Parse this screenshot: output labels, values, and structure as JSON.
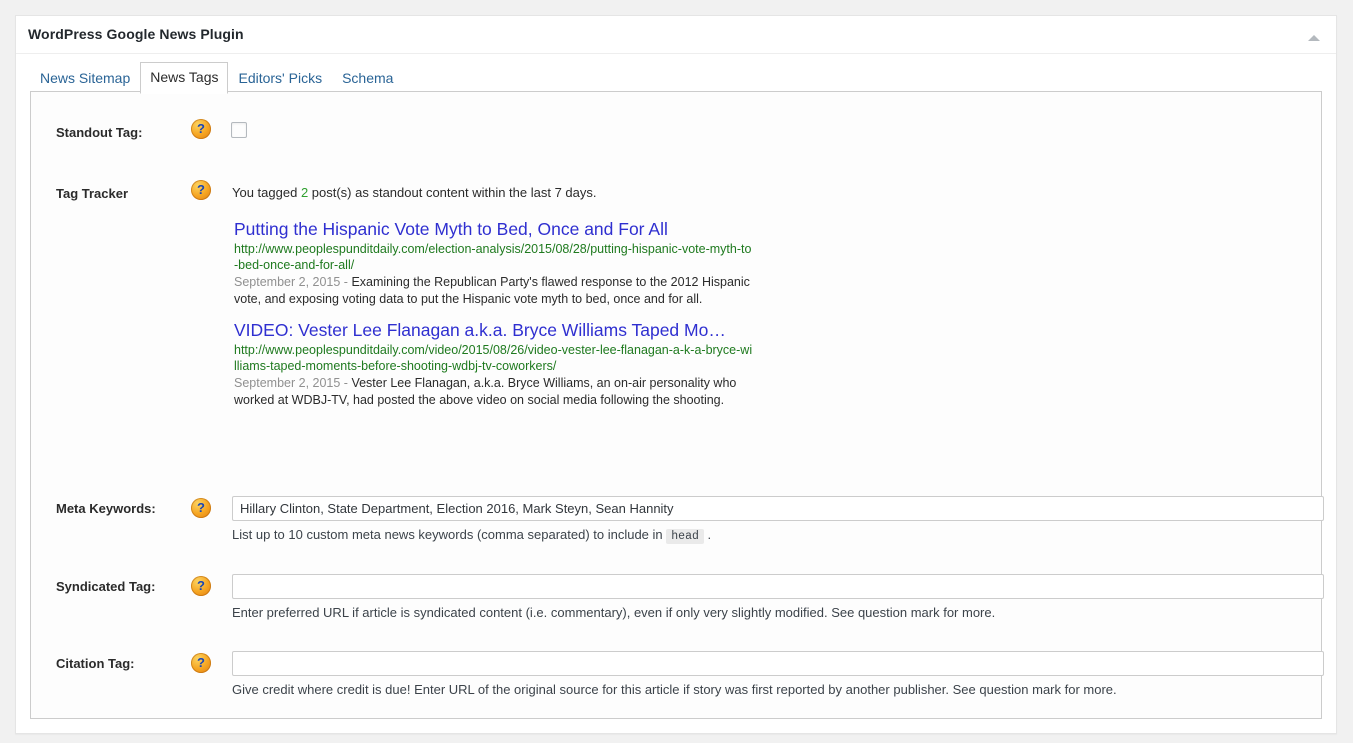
{
  "panel": {
    "title": "WordPress Google News Plugin",
    "collapse_icon": "triangle-up-icon"
  },
  "tabs": [
    {
      "label": "News Sitemap",
      "active": false
    },
    {
      "label": "News Tags",
      "active": true
    },
    {
      "label": "Editors' Picks",
      "active": false
    },
    {
      "label": "Schema",
      "active": false
    }
  ],
  "rows": {
    "standout": {
      "label": "Standout Tag:",
      "help_icon": "help-question-icon",
      "checked": false
    },
    "tracker": {
      "label": "Tag Tracker",
      "help_icon": "help-question-icon",
      "summary_prefix": "You tagged ",
      "count": "2",
      "summary_suffix": " post(s) as standout content within the last 7 days.",
      "results": [
        {
          "title": "Putting the Hispanic Vote Myth to Bed, Once and For All",
          "url": "http://www.peoplespunditdaily.com/election-analysis/2015/08/28/putting-hispanic-vote-myth-to-bed-once-and-for-all/",
          "date": "September 2, 2015 - ",
          "description": "Examining the Republican Party's flawed response to the 2012 Hispanic vote, and exposing voting data to put the Hispanic vote myth to bed, once and for all."
        },
        {
          "title": "VIDEO: Vester Lee Flanagan a.k.a. Bryce Williams Taped Mo…",
          "url": "http://www.peoplespunditdaily.com/video/2015/08/26/video-vester-lee-flanagan-a-k-a-bryce-williams-taped-moments-before-shooting-wdbj-tv-coworkers/",
          "date": "September 2, 2015 - ",
          "description": "Vester Lee Flanagan, a.k.a. Bryce Williams, an on-air personality who worked at WDBJ-TV, had posted the above video on social media following the shooting."
        }
      ]
    },
    "meta_keywords": {
      "label": "Meta Keywords:",
      "help_icon": "help-question-icon",
      "value": "Hillary Clinton, State Department, Election 2016, Mark Steyn, Sean Hannity",
      "placeholder": "",
      "desc_before": "List up to 10 custom meta news keywords (comma separated) to include in ",
      "desc_code": "head",
      "desc_after": " ."
    },
    "syndicated": {
      "label": "Syndicated Tag:",
      "help_icon": "help-question-icon",
      "value": "",
      "placeholder": "",
      "description": "Enter preferred URL if article is syndicated content (i.e. commentary), even if only very slightly modified. See question mark for more."
    },
    "citation": {
      "label": "Citation Tag:",
      "help_icon": "help-question-icon",
      "value": "",
      "placeholder": "",
      "description": "Give credit where credit is due! Enter URL of the original source for this article if story was first reported by another publisher. See question mark for more."
    }
  },
  "colors": {
    "link": "#2a6496",
    "result_title": "#2f2fd0",
    "result_url": "#1f7a1f",
    "count_green": "#2fa02f",
    "help_orange": "#f6a623",
    "help_mark_blue": "#1b46b4"
  }
}
